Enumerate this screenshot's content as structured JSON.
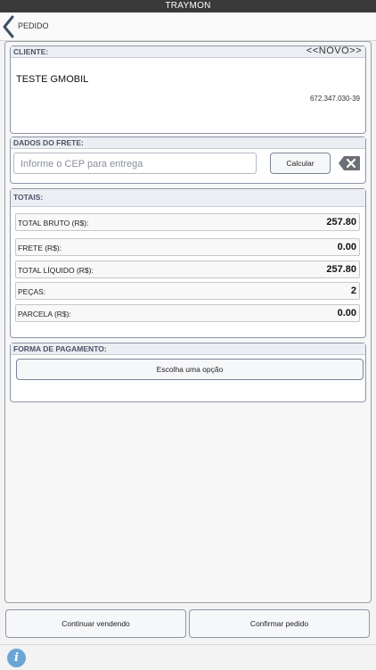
{
  "app": {
    "title": "TRAYMON"
  },
  "nav": {
    "title": "PEDIDO",
    "back_icon": "chevron-left-icon"
  },
  "cliente": {
    "header": "CLIENTE:",
    "status": "<<NOVO>>",
    "name": "TESTE GMOBIL",
    "document": "672.347.030-39"
  },
  "frete": {
    "header": "DADOS DO FRETE:",
    "cep_placeholder": "Informe o CEP para entrega",
    "cep_value": "",
    "calc_label": "Calcular",
    "clear_icon": "backspace-icon"
  },
  "totais": {
    "header": "TOTAIS:",
    "rows": [
      {
        "label": "TOTAL BRUTO (R$):",
        "value": "257.80"
      },
      {
        "label": "FRETE (R$):",
        "value": "0.00"
      },
      {
        "label": "TOTAL LÍQUIDO (R$):",
        "value": "257.80"
      },
      {
        "label": "PEÇAS:",
        "value": "2"
      },
      {
        "label": "PARCELA (R$):",
        "value": "0.00"
      }
    ]
  },
  "pagamento": {
    "header": "FORMA DE PAGAMENTO:",
    "select_label": "Escolha uma opção"
  },
  "footer": {
    "continue_label": "Continuar vendendo",
    "confirm_label": "Confirmar pedido",
    "info_icon": "info-icon"
  },
  "colors": {
    "titlebar": "#3a3a3a",
    "section_border": "#8d96a8",
    "section_header_text": "#4b5366",
    "info_icon": "#6aa5d6"
  }
}
